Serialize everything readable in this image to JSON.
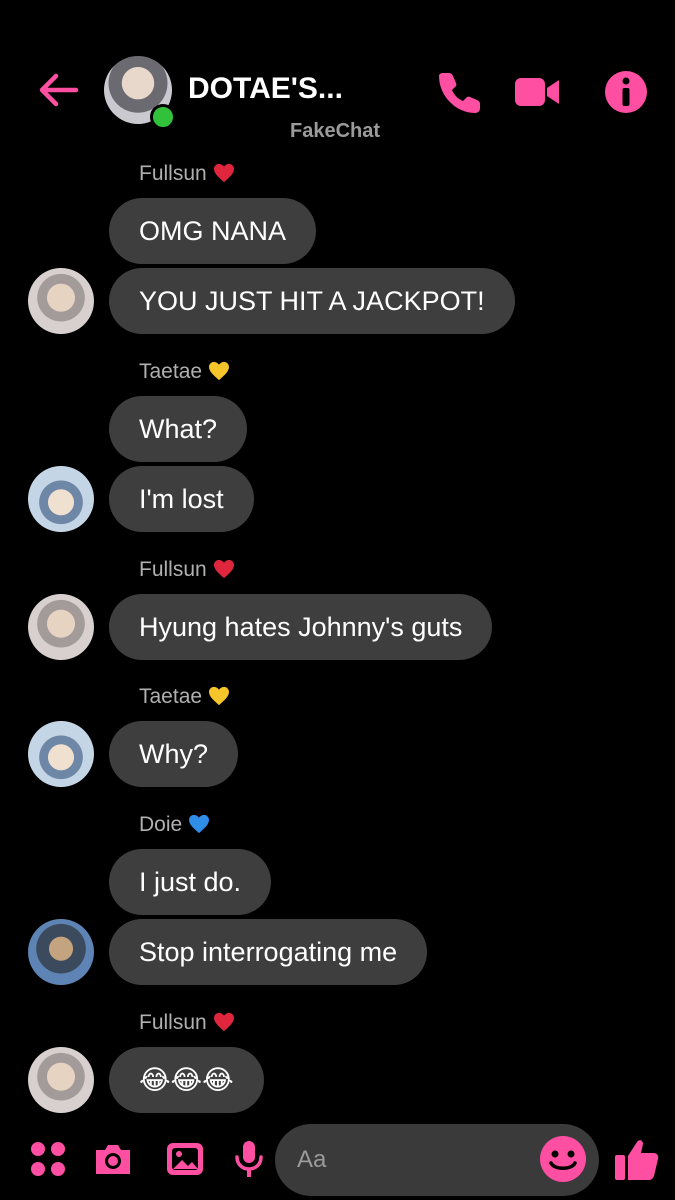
{
  "colors": {
    "accent": "#ff4fa3",
    "bubble": "#3e3e3e",
    "background": "#000000",
    "online": "#31c13a"
  },
  "header": {
    "title": "DOTAE'S...",
    "watermark": "FakeChat",
    "icons": {
      "back": "arrow-left-icon",
      "call": "phone-icon",
      "video": "video-camera-icon",
      "info": "info-icon"
    }
  },
  "messages": [
    {
      "sender": "Fullsun",
      "sender_emoji": "red-heart",
      "bubbles": [
        "OMG NANA",
        "YOU JUST HIT A JACKPOT!"
      ]
    },
    {
      "sender": "Taetae",
      "sender_emoji": "yellow-heart",
      "bubbles": [
        "What?",
        "I'm lost"
      ]
    },
    {
      "sender": "Fullsun",
      "sender_emoji": "red-heart",
      "bubbles": [
        "Hyung hates Johnny's guts"
      ]
    },
    {
      "sender": "Taetae",
      "sender_emoji": "yellow-heart",
      "bubbles": [
        "Why?"
      ]
    },
    {
      "sender": "Doie",
      "sender_emoji": "blue-heart",
      "bubbles": [
        "I just do.",
        "Stop interrogating me"
      ]
    },
    {
      "sender": "Fullsun",
      "sender_emoji": "red-heart",
      "bubbles": [
        "😂😂😂"
      ]
    }
  ],
  "composer": {
    "placeholder": "Aa",
    "icons": [
      "menu-dots-icon",
      "camera-icon",
      "gallery-icon",
      "microphone-icon",
      "emoji-icon",
      "thumbs-up-icon"
    ]
  }
}
